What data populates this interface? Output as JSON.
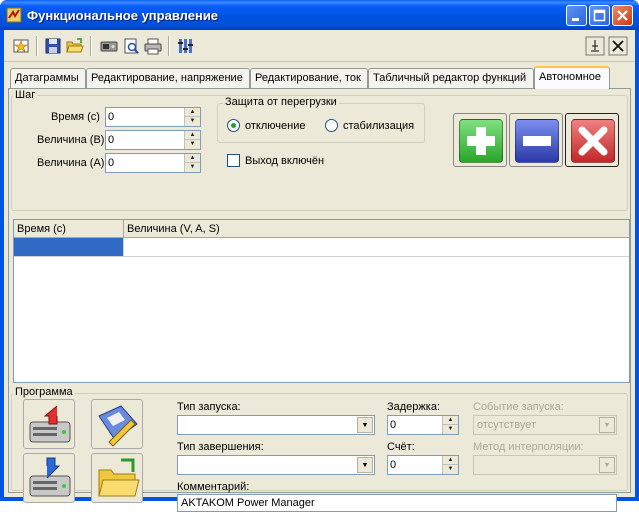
{
  "window": {
    "title": "Функциональное управление"
  },
  "tabs": [
    {
      "label": "Датаграммы"
    },
    {
      "label": "Редактирование, напряжение"
    },
    {
      "label": "Редактирование, ток"
    },
    {
      "label": "Табличный редактор функций"
    },
    {
      "label": "Автономное"
    }
  ],
  "step": {
    "title": "Шаг",
    "time_label": "Время (с)",
    "time_value": "0",
    "voltage_label": "Величина (В)",
    "voltage_value": "0",
    "current_label": "Величина (А)",
    "current_value": "0"
  },
  "protection": {
    "title": "Защита от перегрузки",
    "option_off": "отключение",
    "option_stab": "стабилизация",
    "selected": "отключение"
  },
  "output": {
    "label": "Выход включён",
    "checked": false
  },
  "table": {
    "columns": [
      "Время (с)",
      "Величина (V, A, S)"
    ]
  },
  "program": {
    "title": "Программа",
    "start_type_label": "Тип запуска:",
    "start_type_value": "",
    "end_type_label": "Тип завершения:",
    "end_type_value": "",
    "delay_label": "Задержка:",
    "delay_value": "0",
    "count_label": "Счёт:",
    "count_value": "0",
    "start_event_label": "Событие запуска:",
    "start_event_value": "отсутствует",
    "interp_label": "Метод интерполяции:",
    "interp_value": "",
    "comment_label": "Комментарий:",
    "comment_value": "AKTAKOM Power Manager"
  },
  "colors": {
    "titlebar": "#0054e3",
    "face": "#ece9d8",
    "add": "#3fbf3f",
    "remove": "#3b4fc8",
    "delete": "#d23a3a",
    "selection": "#316ac5"
  }
}
